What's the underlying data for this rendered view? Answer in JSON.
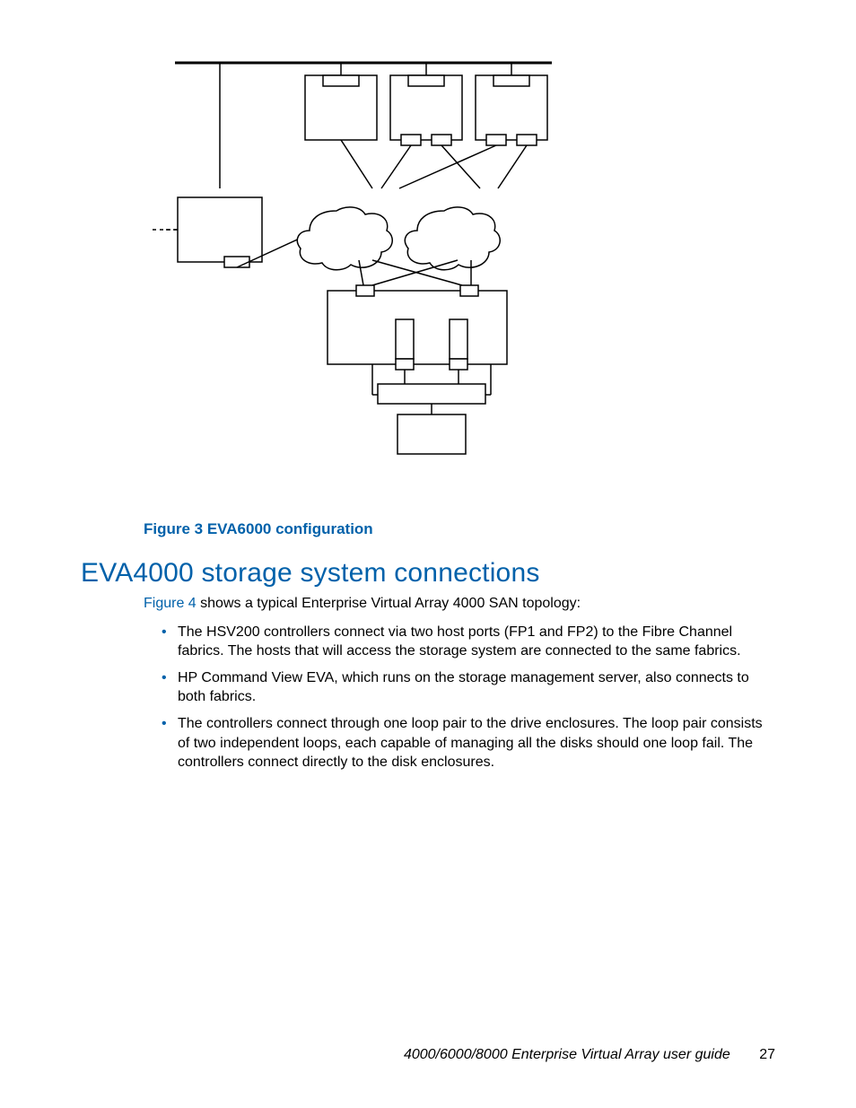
{
  "figure": {
    "caption": "Figure 3 EVA6000 configuration"
  },
  "section": {
    "heading": "EVA4000 storage system connections",
    "intro_xref": "Figure 4",
    "intro_rest": " shows a typical Enterprise Virtual Array 4000 SAN topology:",
    "bullets": [
      "The HSV200 controllers connect via two host ports (FP1 and FP2) to the Fibre Channel fabrics. The hosts that will access the storage system are connected to the same fabrics.",
      "HP Command View EVA, which runs on the storage management server, also connects to both fabrics.",
      "The controllers connect through one loop pair to the drive enclosures. The loop pair consists of two independent loops, each capable of managing all the disks should one loop fail. The controllers connect directly to the disk enclosures."
    ]
  },
  "footer": {
    "title": "4000/6000/8000 Enterprise Virtual Array user guide",
    "page": "27"
  }
}
